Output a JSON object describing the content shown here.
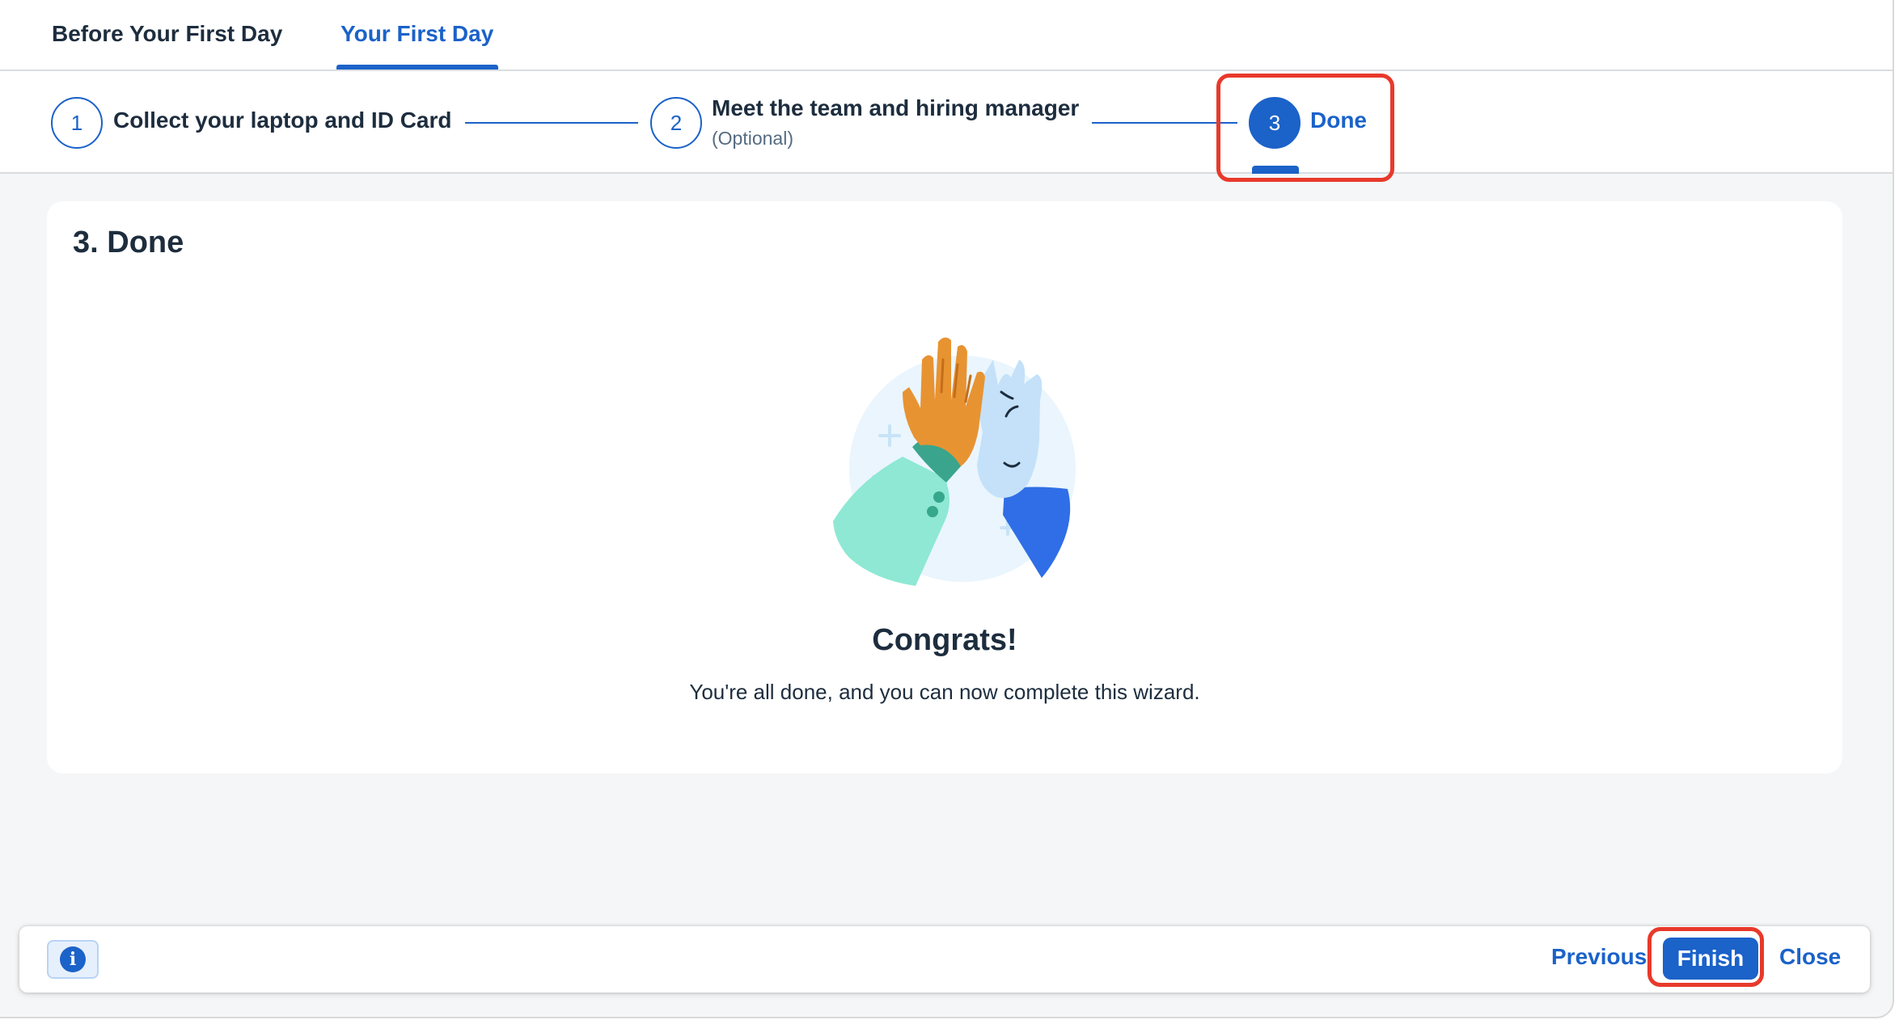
{
  "tabs": [
    {
      "label": "Before Your First Day",
      "selected": false
    },
    {
      "label": "Your First Day",
      "selected": true
    }
  ],
  "wizard": {
    "steps": [
      {
        "number": "1",
        "title": "Collect your laptop and ID Card",
        "subtitle": ""
      },
      {
        "number": "2",
        "title": "Meet the team and hiring manager",
        "subtitle": "(Optional)"
      },
      {
        "number": "3",
        "title": "Done",
        "subtitle": "",
        "active": true
      }
    ]
  },
  "content": {
    "title": "3. Done",
    "illustration_icon": "high-five-illustration",
    "heading": "Congrats!",
    "message": "You're all done, and you can now complete this wizard."
  },
  "footer": {
    "info_icon": "info-icon",
    "previous_label": "Previous",
    "finish_label": "Finish",
    "close_label": "Close"
  },
  "colors": {
    "accent": "#1b62c9",
    "highlight": "#e8392b",
    "background": "#f5f6f7"
  }
}
